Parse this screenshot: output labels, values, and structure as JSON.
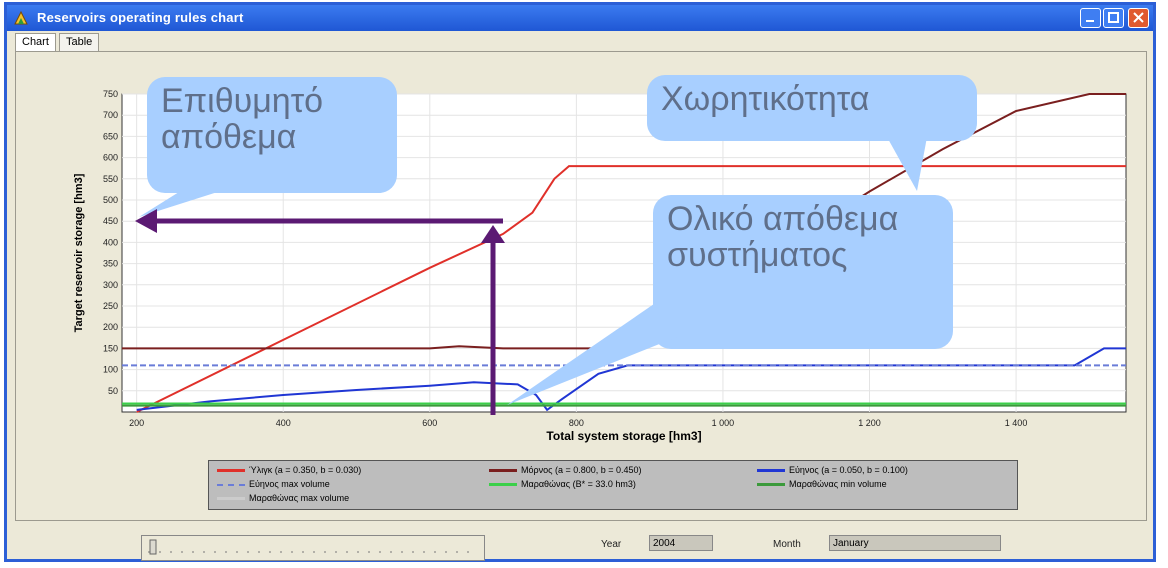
{
  "window": {
    "title": "Reservoirs operating rules chart",
    "accent": "#2c5fd6"
  },
  "tabs": [
    {
      "label": "Chart",
      "active": true
    },
    {
      "label": "Table",
      "active": false
    }
  ],
  "chart_data": {
    "type": "line",
    "title": "",
    "xlabel": "Total system storage [hm3]",
    "ylabel": "Target reservoir storage [hm3]",
    "xlim": [
      180,
      1550
    ],
    "ylim": [
      0,
      750
    ],
    "xticks": [
      {
        "value": 200,
        "label": "200"
      },
      {
        "value": 400,
        "label": "400"
      },
      {
        "value": 600,
        "label": "600"
      },
      {
        "value": 800,
        "label": "800"
      },
      {
        "value": 1000,
        "label": "1 000"
      },
      {
        "value": 1200,
        "label": "1 200"
      },
      {
        "value": 1400,
        "label": "1 400"
      }
    ],
    "yticks": [
      50,
      100,
      150,
      200,
      250,
      300,
      350,
      400,
      450,
      500,
      550,
      600,
      650,
      700,
      750
    ],
    "grid": true,
    "legend_position": "bottom",
    "series": [
      {
        "name": "Ύλιγκ (a = 0.350, b = 0.030)",
        "color": "#e0302a",
        "points": [
          [
            200,
            0
          ],
          [
            400,
            170
          ],
          [
            600,
            340
          ],
          [
            700,
            420
          ],
          [
            740,
            470
          ],
          [
            770,
            550
          ],
          [
            790,
            580
          ],
          [
            850,
            580
          ],
          [
            900,
            580
          ],
          [
            1550,
            580
          ]
        ]
      },
      {
        "name": "Μόρνος (a = 0.800, b = 0.450)",
        "color": "#7a1f1f",
        "points": [
          [
            180,
            150
          ],
          [
            600,
            150
          ],
          [
            640,
            155
          ],
          [
            700,
            150
          ],
          [
            860,
            150
          ],
          [
            900,
            190
          ],
          [
            1000,
            300
          ],
          [
            1100,
            410
          ],
          [
            1200,
            520
          ],
          [
            1300,
            620
          ],
          [
            1400,
            710
          ],
          [
            1500,
            750
          ],
          [
            1550,
            750
          ]
        ]
      },
      {
        "name": "Εύηνος (a = 0.050, b = 0.100)",
        "color": "#2036d4",
        "points": [
          [
            200,
            5
          ],
          [
            300,
            25
          ],
          [
            400,
            40
          ],
          [
            500,
            52
          ],
          [
            600,
            62
          ],
          [
            660,
            70
          ],
          [
            720,
            65
          ],
          [
            745,
            40
          ],
          [
            760,
            5
          ],
          [
            780,
            30
          ],
          [
            830,
            90
          ],
          [
            870,
            110
          ],
          [
            1000,
            110
          ],
          [
            1200,
            110
          ],
          [
            1480,
            110
          ],
          [
            1520,
            150
          ],
          [
            1550,
            150
          ]
        ]
      },
      {
        "name": "Εύηνος max volume",
        "color": "#6a7cd8",
        "dashed": true,
        "points": [
          [
            180,
            110
          ],
          [
            1550,
            110
          ]
        ]
      },
      {
        "name": "Μαραθώνας (B* = 33.0 hm3)",
        "color": "#3bd04a",
        "points": [
          [
            180,
            20
          ],
          [
            1550,
            20
          ]
        ]
      },
      {
        "name": "Μαραθώνας min volume",
        "color": "#3b9a3b",
        "points": [
          [
            180,
            15
          ],
          [
            1550,
            15
          ]
        ]
      },
      {
        "name": "Μαραθώνας max volume",
        "color": "#cccccc",
        "points": []
      }
    ]
  },
  "annotations": {
    "desired_storage": "Επιθυμητό απόθεμα",
    "capacity": "Χωρητικότητα",
    "total_system_storage": "Ολικό απόθεμα συστήματος",
    "arrow_color": "#5b1a73",
    "bubble_color": "#a8cfff"
  },
  "controls": {
    "year_label": "Year",
    "year_value": "2004",
    "month_label": "Month",
    "month_value": "January"
  }
}
